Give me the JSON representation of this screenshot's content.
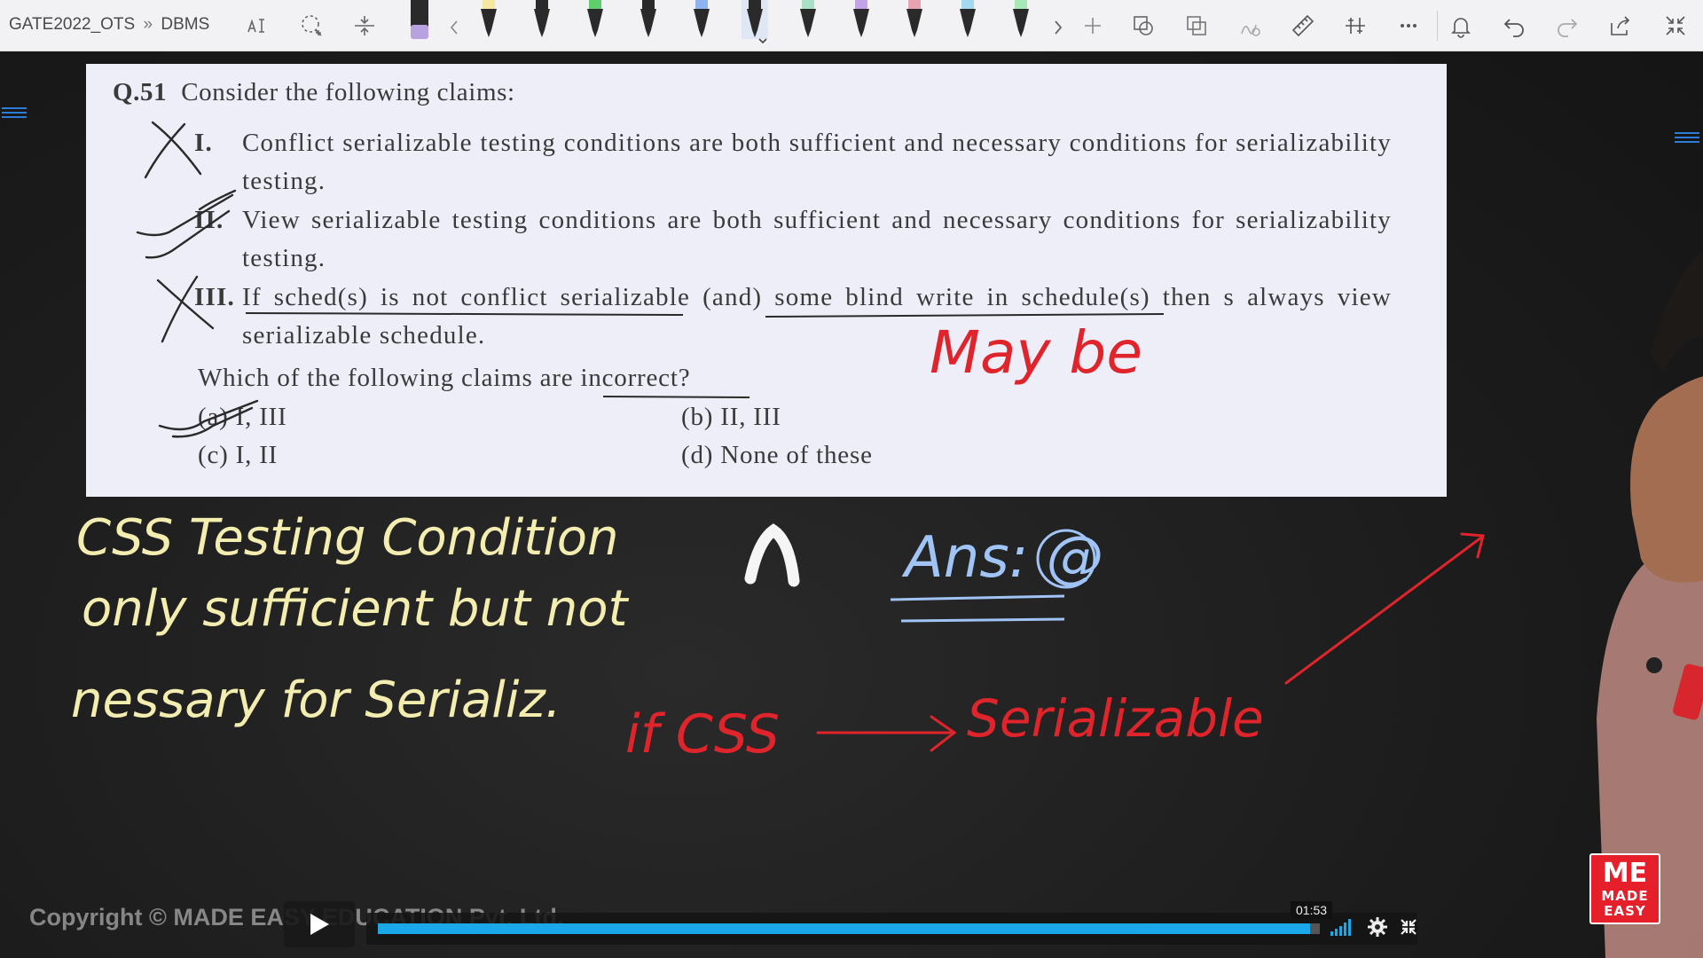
{
  "toolbar": {
    "breadcrumb_notebook": "GATE2022_OTS",
    "breadcrumb_separator": "»",
    "breadcrumb_page": "DBMS",
    "tools": [
      "text-select-icon",
      "lasso-icon",
      "insert-space-icon",
      "highlighter-icon",
      "pen-icon",
      "shape-icon",
      "image-icon",
      "math-icon",
      "ruler-icon",
      "adjust-icon",
      "more-icon",
      "notification-icon",
      "undo-icon",
      "redo-icon",
      "share-icon",
      "fullscreen-icon"
    ],
    "pen_colors": [
      "#b8a3e0",
      "#f5e6a0",
      "#2a2a2a",
      "#5fcf6d",
      "#2a2a2a",
      "#8fb3f0",
      "#2a2a2a",
      "#a8e0c8",
      "#c3a3e8",
      "#e8a3b3",
      "#a3d8f0",
      "#a8e8b8"
    ]
  },
  "question": {
    "number": "Q.51",
    "intro": "Consider the following claims:",
    "claims": [
      {
        "num": "I.",
        "text": "Conflict serializable testing conditions are both sufficient and necessary conditions for serializability testing."
      },
      {
        "num": "II.",
        "text": "View serializable testing conditions are both sufficient and necessary conditions for serializability testing."
      },
      {
        "num": "III.",
        "text": "If sched(s) is not conflict serializable (and) some blind write in schedule(s) then s always view serializable schedule."
      }
    ],
    "sub_question": "Which of the following claims are incorrect?",
    "options": [
      {
        "label": "(a)",
        "text": "I, III"
      },
      {
        "label": "(b)",
        "text": "II, III"
      },
      {
        "label": "(c)",
        "text": "I, II"
      },
      {
        "label": "(d)",
        "text": "None of these"
      }
    ]
  },
  "annotations": {
    "red_note_maybe": "May be",
    "yellow_line1": "CSS Testing Condition",
    "yellow_line2": "only sufficient but not",
    "yellow_line3": "nessary for Serializ.",
    "answer": "Ans: @",
    "red_css": "if CSS",
    "red_arrow_target": "Serializable",
    "colors": {
      "red": "#e0242b",
      "yellow": "#f3edb0",
      "blue": "#9fc4f5",
      "white": "#f5f5f5"
    }
  },
  "video": {
    "copyright": "Copyright © MADE EASY EDUCATION Pvt. Ltd.",
    "timestamp": "01:53",
    "progress": 0.99,
    "logo_line1": "MADE",
    "logo_line2": "EASY"
  }
}
